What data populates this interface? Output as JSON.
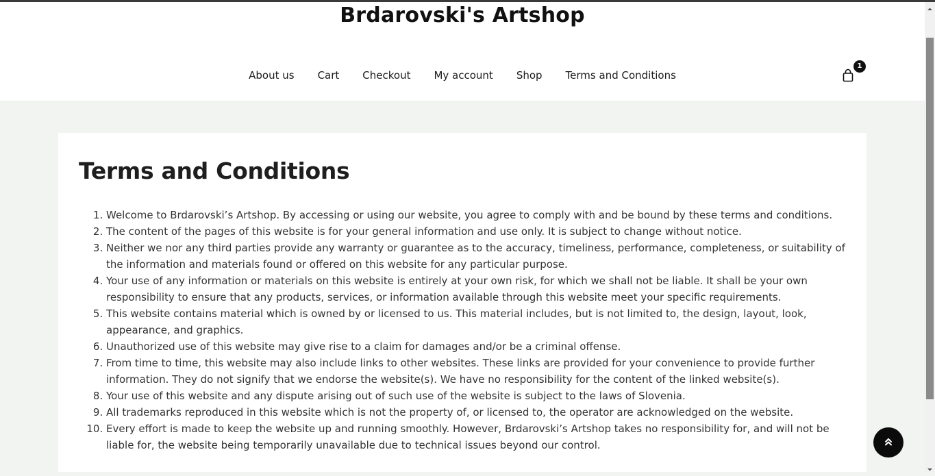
{
  "header": {
    "site_title": "Brdarovski's Artshop",
    "nav": [
      "About us",
      "Cart",
      "Checkout",
      "My account",
      "Shop",
      "Terms and Conditions"
    ],
    "cart_count": "1",
    "cart_icon": "shopping-bag-icon"
  },
  "page": {
    "title": "Terms and Conditions",
    "terms": [
      "Welcome to Brdarovski’s Artshop. By accessing or using our website, you agree to comply with and be bound by these terms and conditions.",
      "The content of the pages of this website is for your general information and use only. It is subject to change without notice.",
      "Neither we nor any third parties provide any warranty or guarantee as to the accuracy, timeliness, performance, completeness, or suitability of the information and materials found or offered on this website for any particular purpose.",
      "Your use of any information or materials on this website is entirely at your own risk, for which we shall not be liable. It shall be your own responsibility to ensure that any products, services, or information available through this website meet your specific requirements.",
      "This website contains material which is owned by or licensed to us. This material includes, but is not limited to, the design, layout, look, appearance, and graphics.",
      "Unauthorized use of this website may give rise to a claim for damages and/or be a criminal offense.",
      "From time to time, this website may also include links to other websites. These links are provided for your convenience to provide further information. They do not signify that we endorse the website(s). We have no responsibility for the content of the linked website(s).",
      "Your use of this website and any dispute arising out of such use of the website is subject to the laws of Slovenia.",
      "All trademarks reproduced in this website which is not the property of, or licensed to, the operator are acknowledged on the website.",
      "Every effort is made to keep the website up and running smoothly. However, Brdarovski’s Artshop takes no responsibility for, and will not be liable for, the website being temporarily unavailable due to technical issues beyond our control."
    ]
  },
  "back_to_top_icon": "double-chevron-up-icon",
  "colors": {
    "page_background": "#f1f4f1",
    "header_background": "#ffffff",
    "text": "#333333",
    "accent_dark": "#0b0b0b"
  }
}
